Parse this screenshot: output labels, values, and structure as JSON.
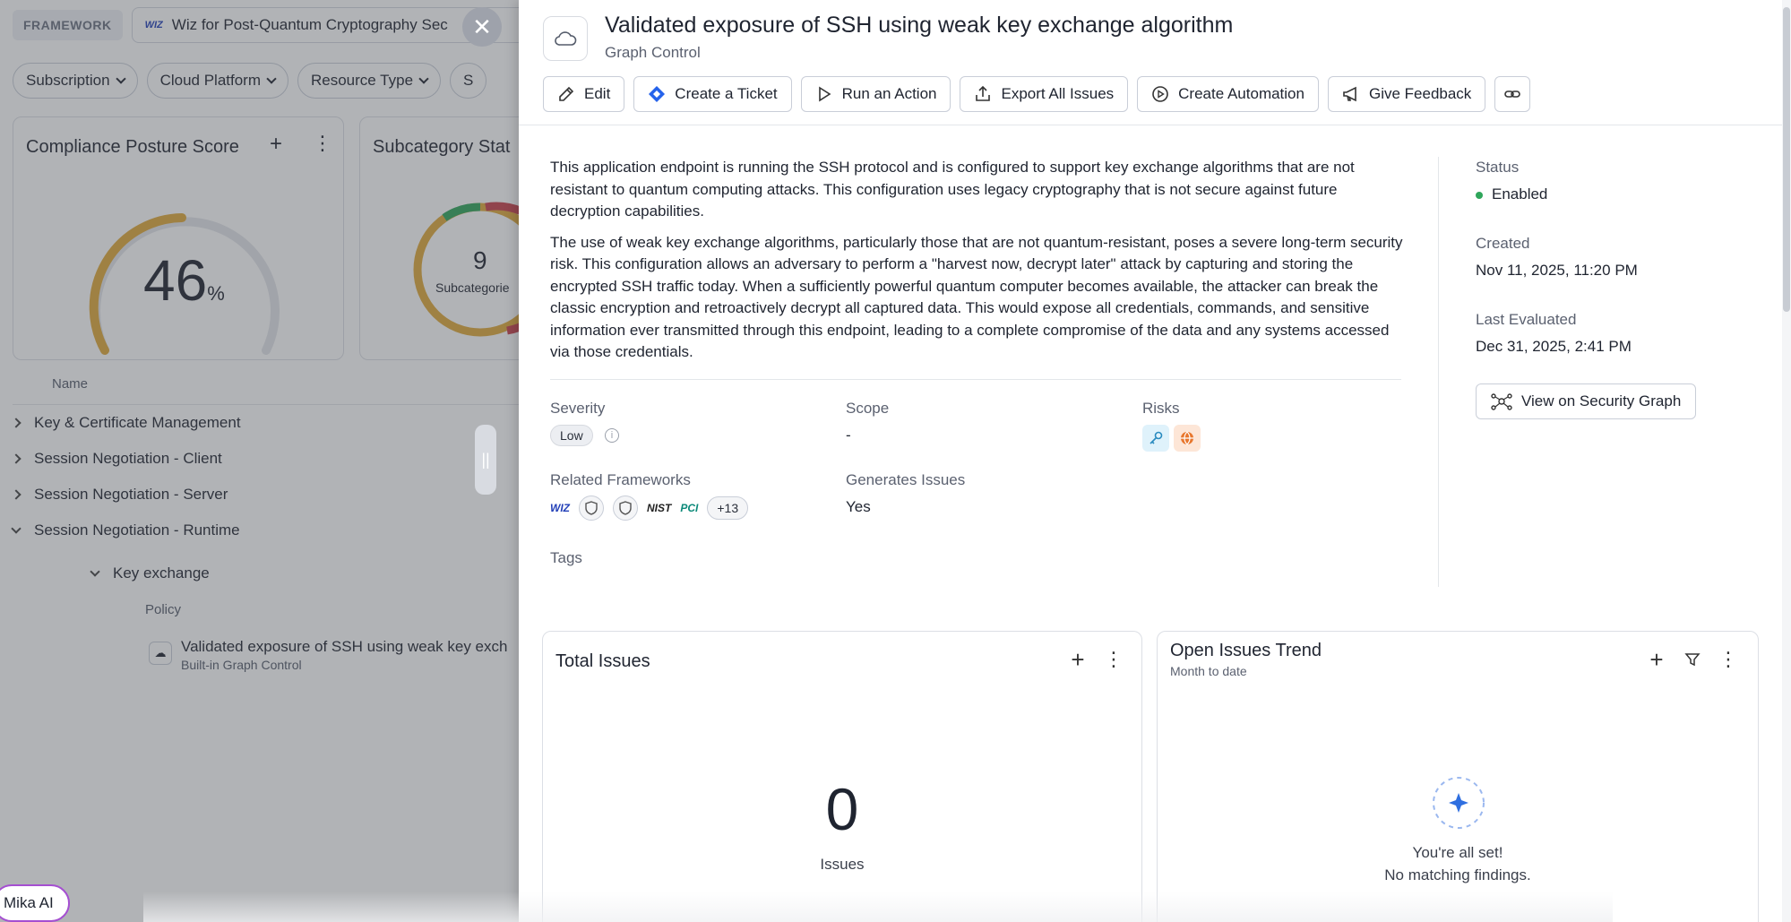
{
  "background": {
    "framework_tag": "FRAMEWORK",
    "framework_select": "Wiz for Post-Quantum Cryptography Sec",
    "filters": [
      "Subscription",
      "Cloud Platform",
      "Resource Type",
      "S"
    ],
    "cards": {
      "compliance_title": "Compliance Posture Score",
      "score": "46",
      "score_unit": "%",
      "subcategory_title": "Subcategory Stat",
      "subcategory_count": "9",
      "subcategory_label": "Subcategorie"
    },
    "tree": {
      "header": "Name",
      "items": [
        "Key & Certificate Management",
        "Session Negotiation - Client",
        "Session Negotiation - Server",
        "Session Negotiation - Runtime"
      ],
      "child": "Key exchange",
      "policy_header": "Policy",
      "policy_title": "Validated exposure of SSH using weak key exch",
      "policy_sub": "Built-in Graph Control"
    },
    "mika": "Mika AI"
  },
  "drawer": {
    "title": "Validated exposure of SSH using weak key exchange algorithm",
    "subtitle": "Graph Control",
    "actions": {
      "edit": "Edit",
      "ticket": "Create a Ticket",
      "run": "Run an Action",
      "export": "Export All Issues",
      "automation": "Create Automation",
      "feedback": "Give Feedback"
    },
    "description": {
      "p1": "This application endpoint is running the SSH protocol and is configured to support key exchange algorithms that are not resistant to quantum computing attacks. This configuration uses legacy cryptography that is not secure against future decryption capabilities.",
      "p2": "The use of weak key exchange algorithms, particularly those that are not quantum-resistant, poses a severe long-term security risk. This configuration allows an adversary to perform a \"harvest now, decrypt later\" attack by capturing and storing the encrypted SSH traffic today. When a sufficiently powerful quantum computer becomes available, the attacker can break the classic encryption and retroactively decrypt all captured data. This would expose all credentials, commands, and sensitive information ever transmitted through this endpoint, leading to a complete compromise of the data and any systems accessed via those credentials."
    },
    "fields": {
      "severity_label": "Severity",
      "severity_value": "Low",
      "scope_label": "Scope",
      "scope_value": "-",
      "risks_label": "Risks",
      "frameworks_label": "Related Frameworks",
      "frameworks_more": "+13",
      "nist": "NIST",
      "pci": "PCI",
      "generates_label": "Generates Issues",
      "generates_value": "Yes",
      "tags_label": "Tags"
    },
    "side": {
      "status_label": "Status",
      "status_value": "Enabled",
      "created_label": "Created",
      "created_value": "Nov 11, 2025, 11:20 PM",
      "evaluated_label": "Last Evaluated",
      "evaluated_value": "Dec 31, 2025, 2:41 PM",
      "graph_button": "View on Security Graph"
    },
    "widgets": {
      "total_title": "Total Issues",
      "total_value": "0",
      "total_label": "Issues",
      "trend_title": "Open Issues Trend",
      "trend_sub": "Month to date",
      "trend_empty_1": "You're all set!",
      "trend_empty_2": "No matching findings."
    }
  },
  "colors": {
    "status_enabled": "#2fa65b",
    "mika_border": "#a54fd1",
    "gauge_score": "#e0a93a",
    "ticket_blue": "#2563eb"
  }
}
